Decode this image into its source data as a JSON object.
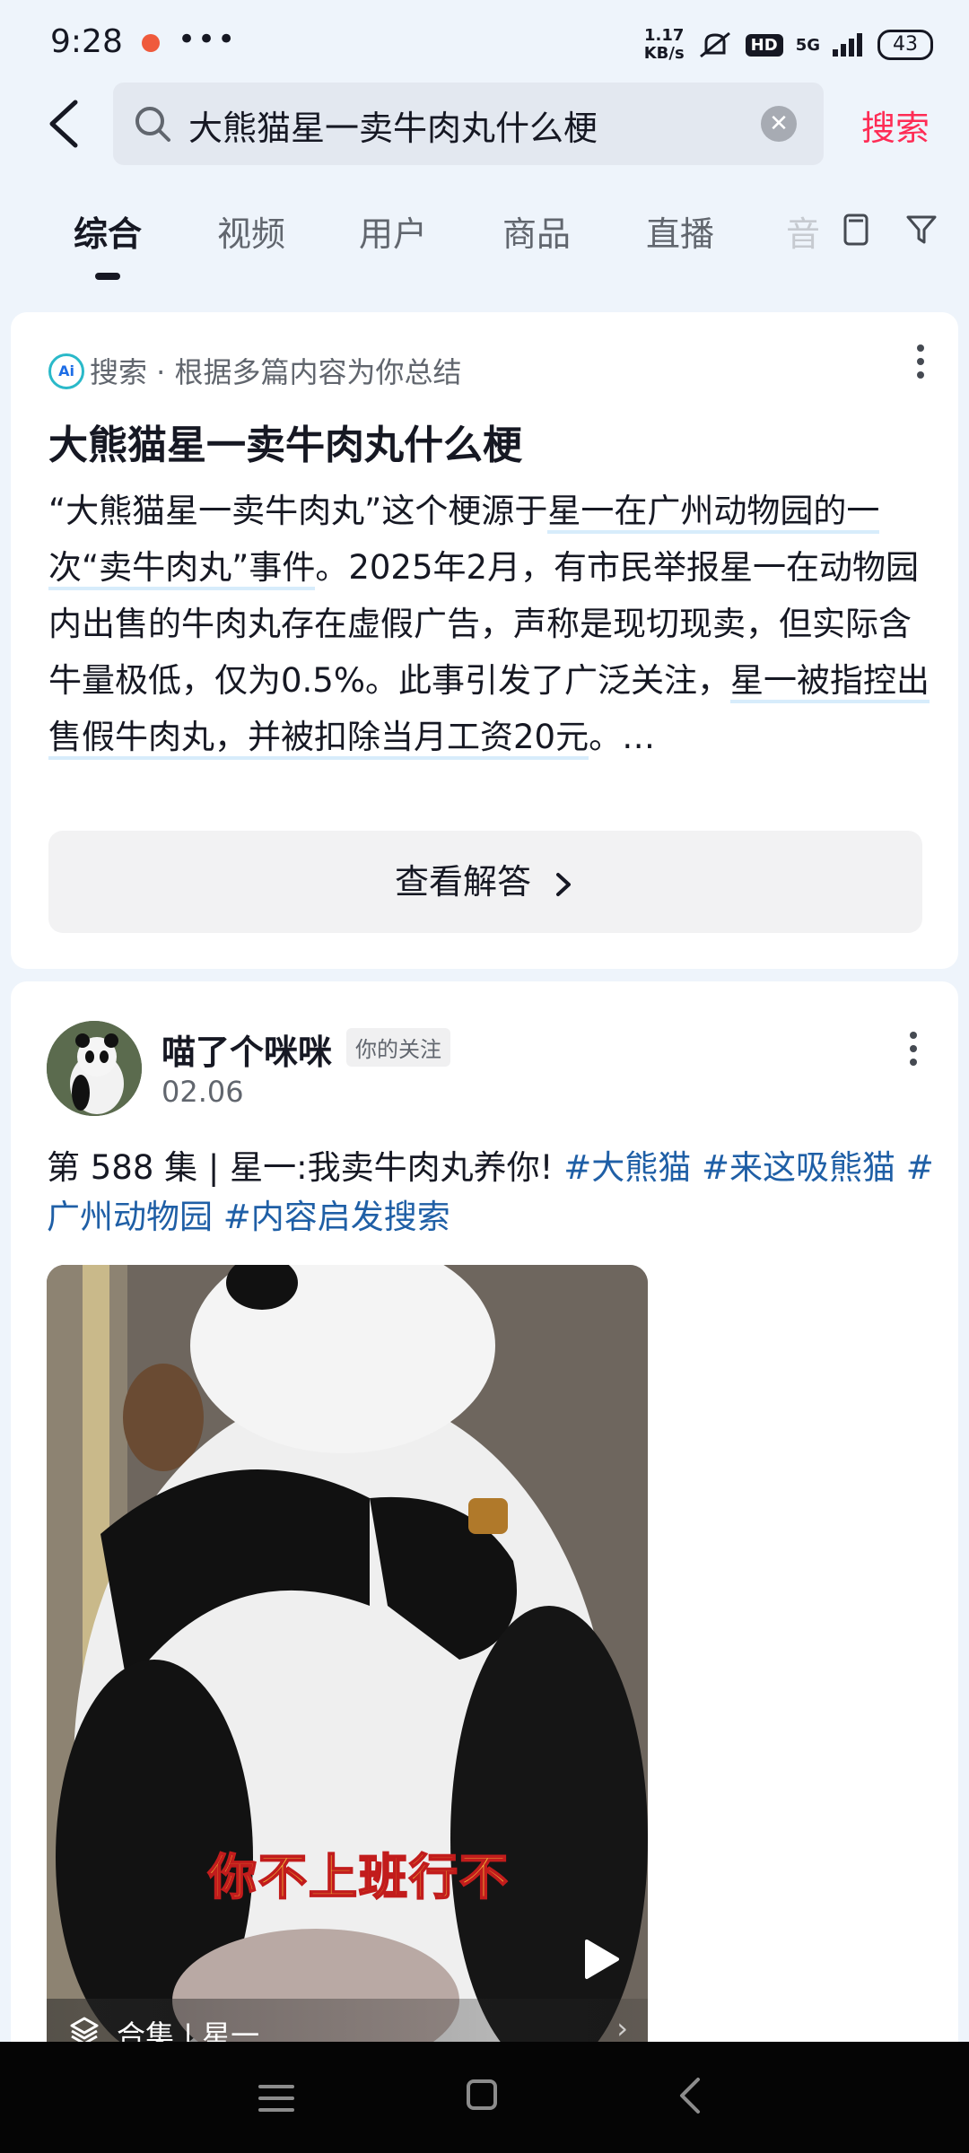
{
  "status_bar": {
    "time": "9:28",
    "more": "•••",
    "net_speed_value": "1.17",
    "net_speed_unit": "KB/s",
    "hd": "HD",
    "network": "5G",
    "battery": "43"
  },
  "header": {
    "query": "大熊猫星一卖牛肉丸什么梗",
    "search_label": "搜索"
  },
  "tabs": [
    {
      "label": "综合",
      "active": true
    },
    {
      "label": "视频"
    },
    {
      "label": "用户"
    },
    {
      "label": "商品"
    },
    {
      "label": "直播"
    },
    {
      "label": "音"
    }
  ],
  "ai_card": {
    "badge": "Ai",
    "source": "搜索 · 根据多篇内容为你总结",
    "title": "大熊猫星一卖牛肉丸什么梗",
    "summary": {
      "p1": "“大熊猫星一卖牛肉丸”这个梗源于",
      "p2": "星一在广州动物园的一次“卖牛肉丸”事件",
      "p3": "。2025年2月，有市民举报星一在动物园内出售的牛肉丸存在虚假广告，声称是现切现卖，但实际含牛量极低，仅为0.5%。此事引发了广泛关注，",
      "p4": "星一被指控出售假牛肉丸，并被扣除当月工资20元",
      "p5": "。…"
    },
    "view_button": "查看解答"
  },
  "post": {
    "username": "喵了个咪咪",
    "follow_badge": "你的关注",
    "date": "02.06",
    "text": "第 588 集 | 星一:我卖牛肉丸养你! ",
    "tags": [
      "#大熊猫",
      "#来这吸熊猫",
      "#广州动物园",
      "#内容启发搜索"
    ],
    "video_caption": "你不上班行不",
    "collection_label": "合集",
    "collection_name": "星一"
  },
  "icons": {
    "back": "chevron-left-icon",
    "search": "magnifier-icon",
    "clear": "clear-circle-icon",
    "filter": "filter-icon",
    "layout": "layout-icon",
    "play": "play-icon",
    "collection": "layers-icon"
  }
}
